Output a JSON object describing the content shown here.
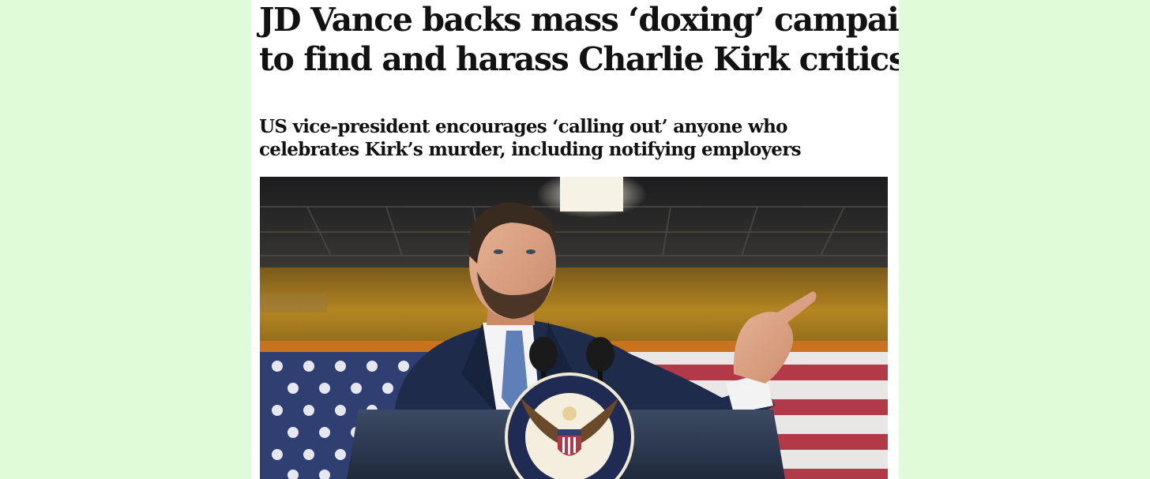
{
  "article": {
    "headline_lines": [
      "JD Vance backs mass ‘doxing’ campaign",
      "to find and harass Charlie Kirk critics"
    ],
    "standfirst_lines": [
      "US vice-president encourages ‘calling out’ anyone who",
      "celebrates Kirk’s murder, including notifying employers"
    ]
  },
  "colors": {
    "page_background": "#dffbd8",
    "article_background": "#ffffff",
    "text": "#121212"
  }
}
